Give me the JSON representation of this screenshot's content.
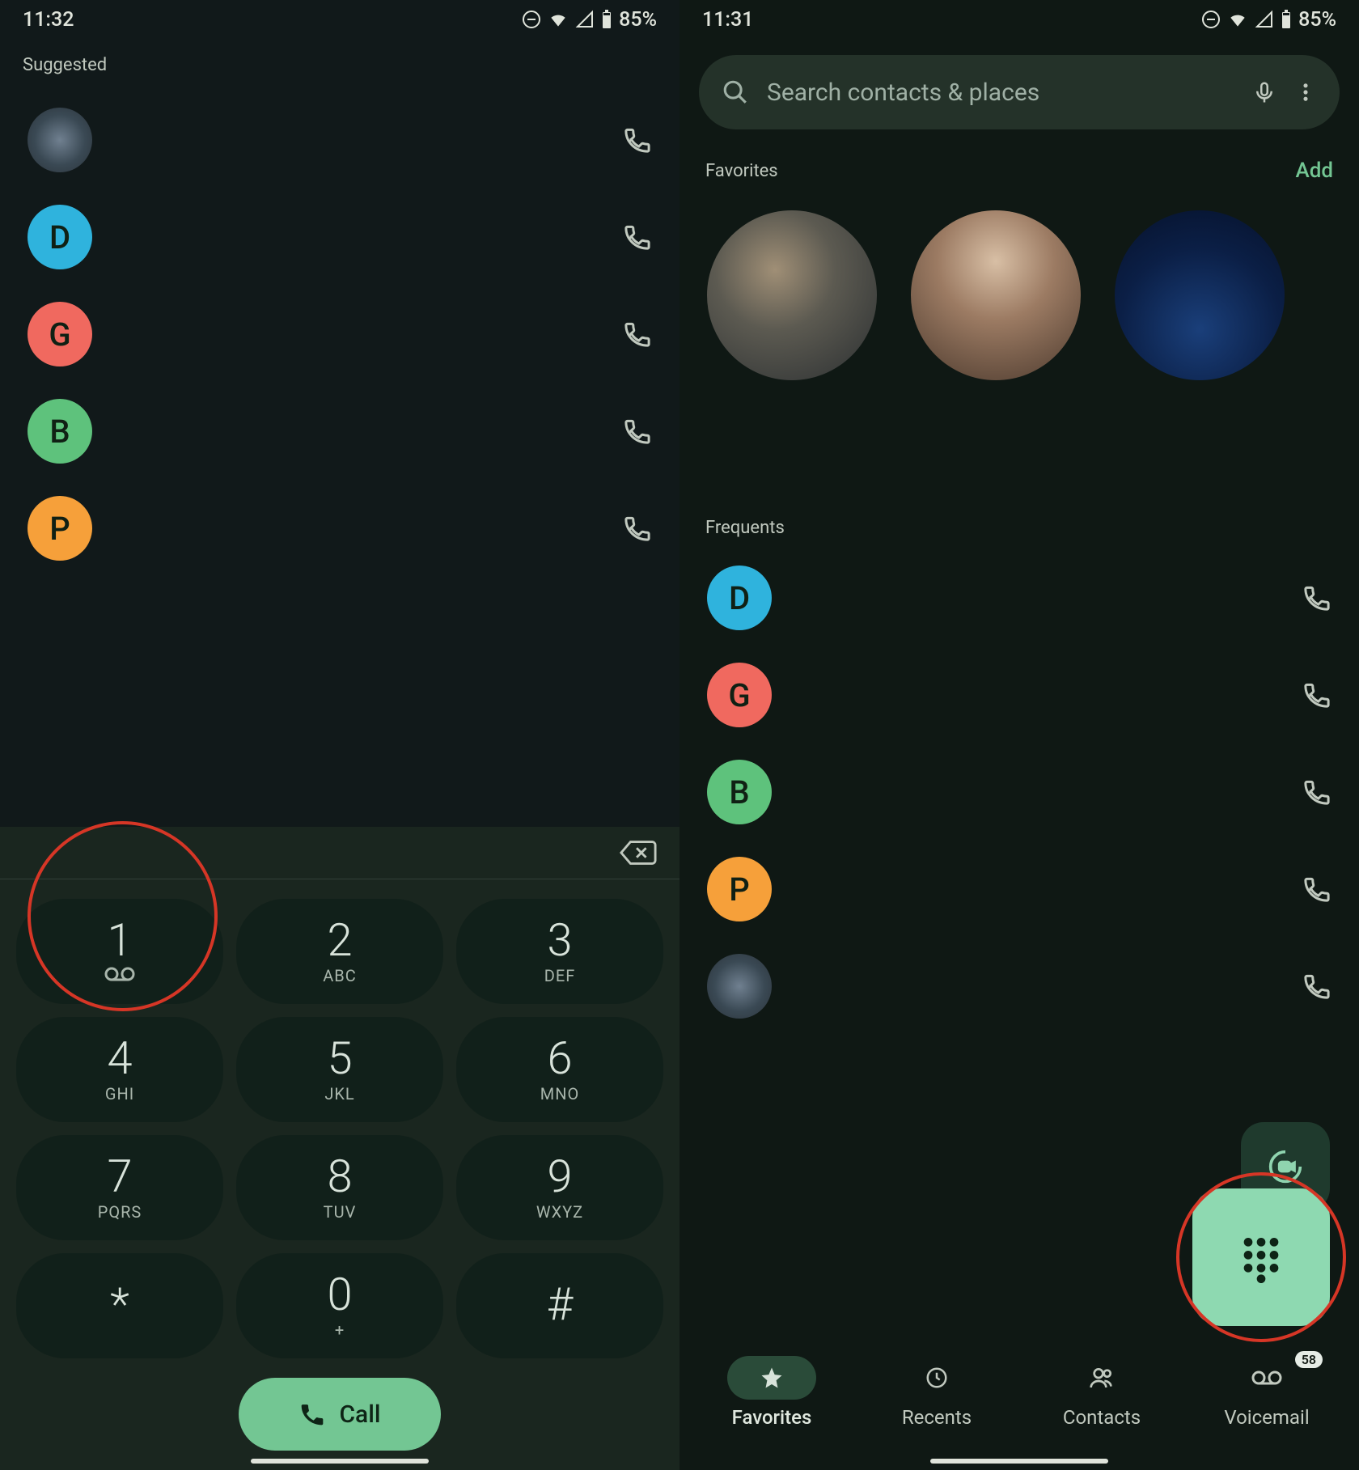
{
  "left": {
    "status": {
      "time": "11:32",
      "battery": "85%"
    },
    "suggested_label": "Suggested",
    "contacts": [
      {
        "avatar_class": "img",
        "letter": ""
      },
      {
        "avatar_class": "blue",
        "letter": "D"
      },
      {
        "avatar_class": "red",
        "letter": "G"
      },
      {
        "avatar_class": "green",
        "letter": "B"
      },
      {
        "avatar_class": "orange",
        "letter": "P"
      }
    ],
    "keypad": [
      {
        "digit": "1",
        "sub_icon": "voicemail"
      },
      {
        "digit": "2",
        "sub": "ABC"
      },
      {
        "digit": "3",
        "sub": "DEF"
      },
      {
        "digit": "4",
        "sub": "GHI"
      },
      {
        "digit": "5",
        "sub": "JKL"
      },
      {
        "digit": "6",
        "sub": "MNO"
      },
      {
        "digit": "7",
        "sub": "PQRS"
      },
      {
        "digit": "8",
        "sub": "TUV"
      },
      {
        "digit": "9",
        "sub": "WXYZ"
      },
      {
        "digit": "*",
        "sub": ""
      },
      {
        "digit": "0",
        "sub": "+"
      },
      {
        "digit": "#",
        "sub": ""
      }
    ],
    "call_label": "Call"
  },
  "right": {
    "status": {
      "time": "11:31",
      "battery": "85%"
    },
    "search_placeholder": "Search contacts & places",
    "favorites_label": "Favorites",
    "add_label": "Add",
    "frequents_label": "Frequents",
    "frequents": [
      {
        "avatar_class": "blue",
        "letter": "D"
      },
      {
        "avatar_class": "red",
        "letter": "G"
      },
      {
        "avatar_class": "green",
        "letter": "B"
      },
      {
        "avatar_class": "orange",
        "letter": "P"
      },
      {
        "avatar_class": "img",
        "letter": ""
      }
    ],
    "nav": {
      "favorites": "Favorites",
      "recents": "Recents",
      "contacts": "Contacts",
      "voicemail": "Voicemail",
      "voicemail_badge": "58"
    }
  }
}
